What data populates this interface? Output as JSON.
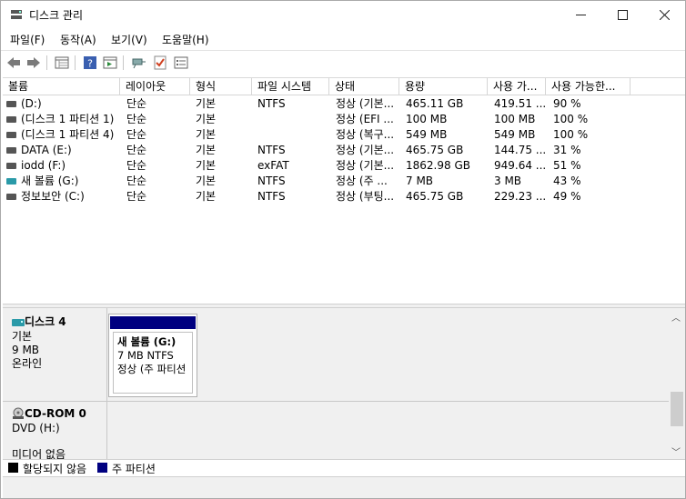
{
  "window": {
    "title": "디스크 관리",
    "minimize": "—",
    "maximize": "☐",
    "close": "✕"
  },
  "menu": [
    "파일(F)",
    "동작(A)",
    "보기(V)",
    "도움말(H)"
  ],
  "toolbar_icons": [
    "back-arrow-icon",
    "forward-arrow-icon",
    "disk-list-icon",
    "help-icon",
    "properties-icon",
    "connect-icon",
    "check-icon",
    "settings-list-icon"
  ],
  "columns": [
    "볼륨",
    "레이아웃",
    "형식",
    "파일 시스템",
    "상태",
    "용량",
    "사용 가...",
    "사용 가능한..."
  ],
  "volumes": [
    {
      "name": "(D:)",
      "layout": "단순",
      "type": "기본",
      "fs": "NTFS",
      "status": "정상 (기본...",
      "capacity": "465.11 GB",
      "free": "419.51 ...",
      "pct": "90 %",
      "icon": "gray"
    },
    {
      "name": "(디스크 1 파티션 1)",
      "layout": "단순",
      "type": "기본",
      "fs": "",
      "status": "정상 (EFI ...",
      "capacity": "100 MB",
      "free": "100 MB",
      "pct": "100 %",
      "icon": "gray"
    },
    {
      "name": "(디스크 1 파티션 4)",
      "layout": "단순",
      "type": "기본",
      "fs": "",
      "status": "정상 (복구...",
      "capacity": "549 MB",
      "free": "549 MB",
      "pct": "100 %",
      "icon": "gray"
    },
    {
      "name": "DATA (E:)",
      "layout": "단순",
      "type": "기본",
      "fs": "NTFS",
      "status": "정상 (기본...",
      "capacity": "465.75 GB",
      "free": "144.75 ...",
      "pct": "31 %",
      "icon": "gray"
    },
    {
      "name": "iodd (F:)",
      "layout": "단순",
      "type": "기본",
      "fs": "exFAT",
      "status": "정상 (기본...",
      "capacity": "1862.98 GB",
      "free": "949.64 ...",
      "pct": "51 %",
      "icon": "gray"
    },
    {
      "name": "새 볼륨 (G:)",
      "layout": "단순",
      "type": "기본",
      "fs": "NTFS",
      "status": "정상 (주 ...",
      "capacity": "7 MB",
      "free": "3 MB",
      "pct": "43 %",
      "icon": "teal"
    },
    {
      "name": "정보보안 (C:)",
      "layout": "단순",
      "type": "기본",
      "fs": "NTFS",
      "status": "정상 (부팅...",
      "capacity": "465.75 GB",
      "free": "229.23 ...",
      "pct": "49 %",
      "icon": "gray"
    }
  ],
  "disk4": {
    "name": "디스크 4",
    "type": "기본",
    "size": "9 MB",
    "state": "온라인",
    "partition": {
      "name": "새 볼륨  (G:)",
      "size_fs": "7 MB NTFS",
      "status": "정상 (주 파티션"
    }
  },
  "cdrom": {
    "name": "CD-ROM 0",
    "drive": "DVD (H:)",
    "media": "미디어 없음"
  },
  "legend": {
    "unallocated": "할당되지 않음",
    "primary": "주 파티션",
    "colors": {
      "unallocated": "#000000",
      "primary": "#000080"
    }
  }
}
